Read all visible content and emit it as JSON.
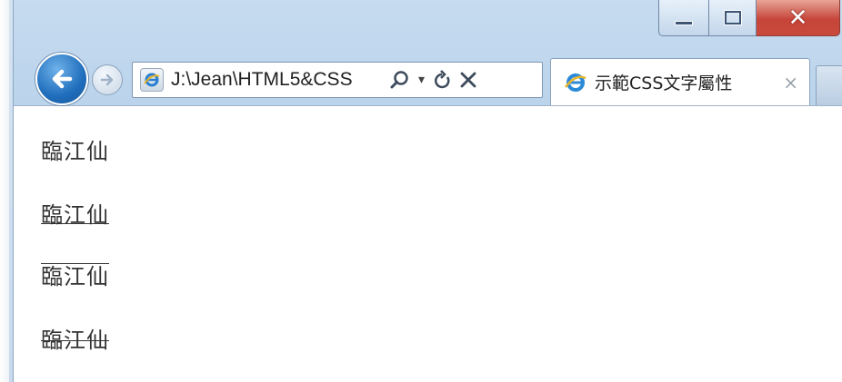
{
  "window": {
    "caption_buttons": {
      "minimize": "minimize-icon",
      "maximize": "maximize-icon",
      "close": "close-icon"
    }
  },
  "nav": {
    "back_icon": "back-arrow-icon",
    "forward_icon": "forward-arrow-icon",
    "address": "J:\\Jean\\HTML5&CSS",
    "address_tools": [
      "search-icon",
      "dropdown-icon",
      "refresh-icon",
      "stop-icon"
    ]
  },
  "tab": {
    "title": "示範CSS文字屬性",
    "close_label": "×",
    "icon": "ie-page-icon"
  },
  "content": {
    "lines": [
      {
        "text": "臨江仙",
        "decoration": "none"
      },
      {
        "text": "臨江仙",
        "decoration": "underline"
      },
      {
        "text": "臨江仙",
        "decoration": "overline"
      },
      {
        "text": "臨江仙",
        "decoration": "line-through"
      }
    ]
  },
  "colors": {
    "frame": "#b5d0ea",
    "back_button": "#1f6dbc",
    "close_button": "#c7453a",
    "text": "#333333"
  }
}
